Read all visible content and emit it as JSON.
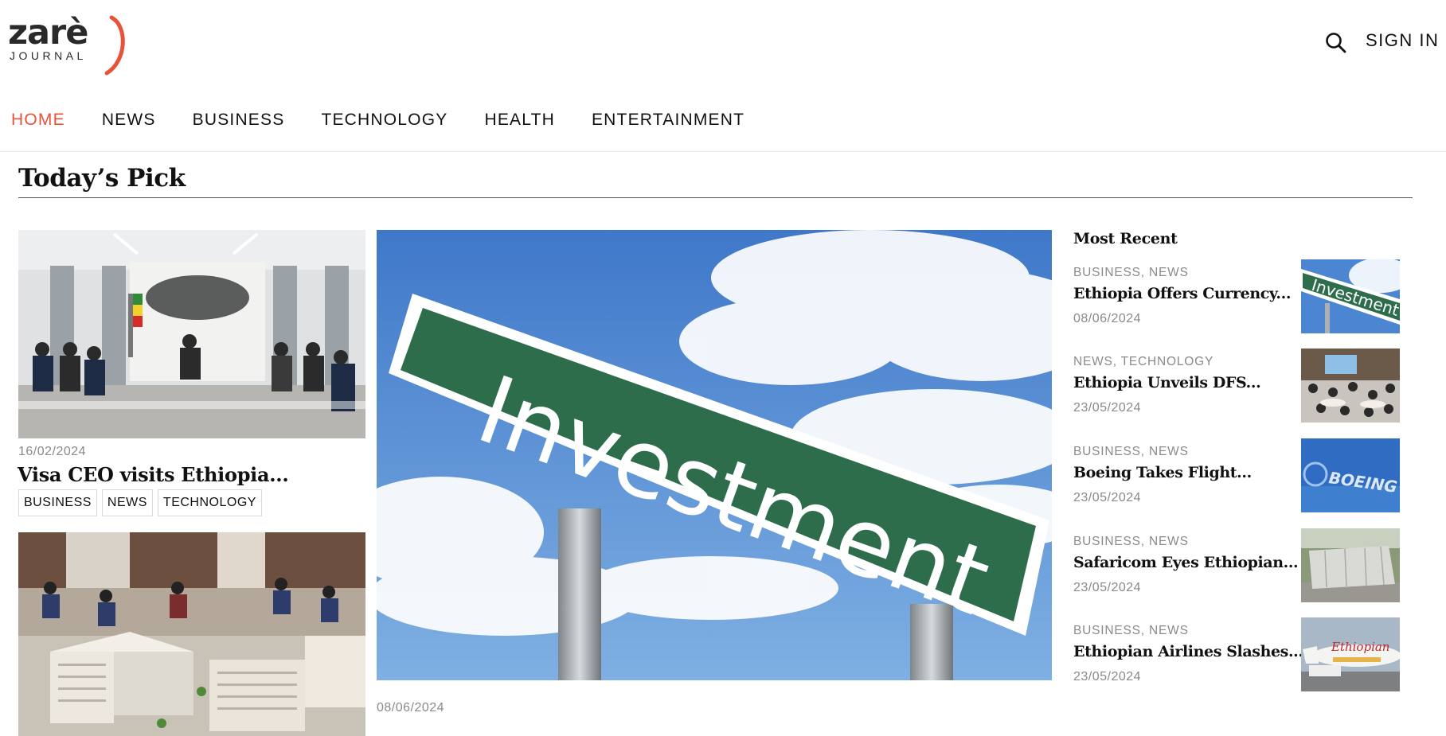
{
  "brand": {
    "name": "zarè",
    "sub": "JOURNAL",
    "accent": "#e8523a"
  },
  "header": {
    "signin": "SIGN IN",
    "search_icon": "search-icon"
  },
  "nav": [
    {
      "label": "HOME",
      "active": true
    },
    {
      "label": "NEWS"
    },
    {
      "label": "BUSINESS"
    },
    {
      "label": "TECHNOLOGY"
    },
    {
      "label": "HEALTH"
    },
    {
      "label": "ENTERTAINMENT"
    }
  ],
  "section": {
    "title": "Today’s Pick"
  },
  "featured_left": {
    "date": "16/02/2024",
    "title": "Visa CEO visits Ethiopia...",
    "tags": [
      "BUSINESS",
      "NEWS",
      "TECHNOLOGY"
    ]
  },
  "hero": {
    "sign_text": "Investment",
    "date": "08/06/2024"
  },
  "most_recent": {
    "title": "Most Recent",
    "items": [
      {
        "cats": [
          "BUSINESS",
          "NEWS"
        ],
        "title": "Ethiopia Offers Currency...",
        "date": "08/06/2024",
        "thumb_label": "Investment"
      },
      {
        "cats": [
          "NEWS",
          "TECHNOLOGY"
        ],
        "title": "Ethiopia Unveils DFS...",
        "date": "23/05/2024"
      },
      {
        "cats": [
          "BUSINESS",
          "NEWS"
        ],
        "title": "Boeing Takes Flight...",
        "date": "23/05/2024",
        "thumb_label": "BOEING"
      },
      {
        "cats": [
          "BUSINESS",
          "NEWS"
        ],
        "title": "Safaricom Eyes Ethiopian...",
        "date": "23/05/2024"
      },
      {
        "cats": [
          "BUSINESS",
          "NEWS"
        ],
        "title": "Ethiopian Airlines Slashes...",
        "date": "23/05/2024",
        "thumb_label": "Ethiopian"
      }
    ]
  }
}
